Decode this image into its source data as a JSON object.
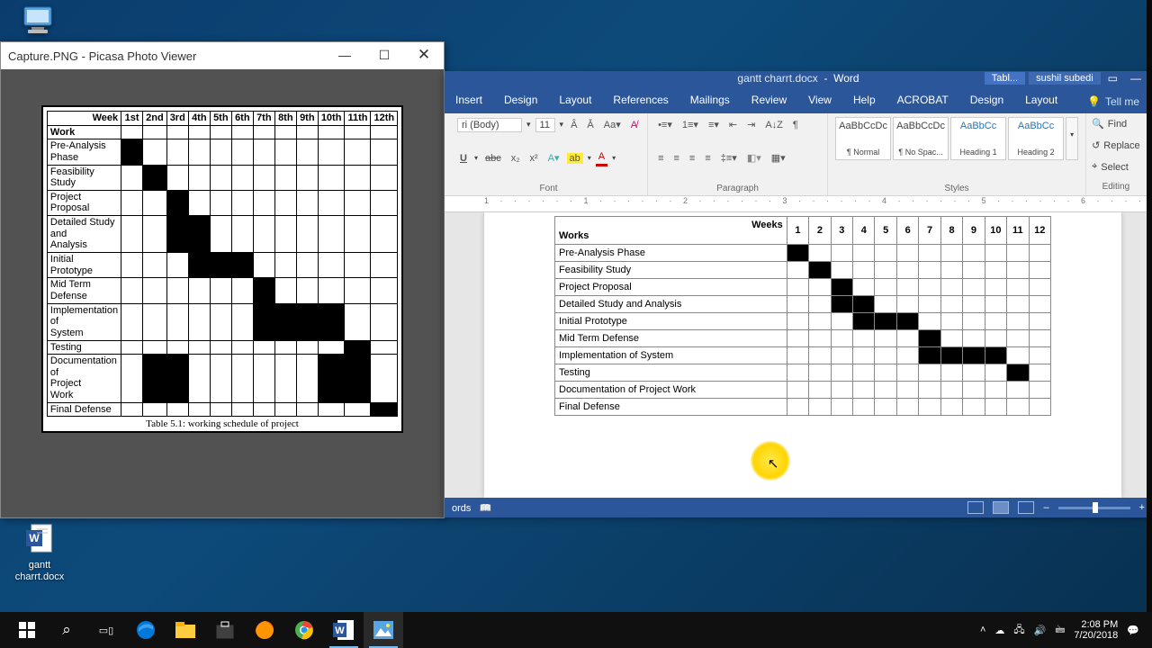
{
  "desktop": {
    "this_pc": "",
    "word_doc_label": "gantt\ncharrt.docx"
  },
  "picasa": {
    "title": "Capture.PNG - Picasa Photo Viewer",
    "caption": "Table 5.1: working schedule of project",
    "header_week_label": "Week",
    "header_work_label": "Work"
  },
  "chart_data": {
    "type": "table",
    "title": "Working schedule of project (Gantt chart)",
    "picasa": {
      "columns": [
        "1st",
        "2nd",
        "3rd",
        "4th",
        "5th",
        "6th",
        "7th",
        "8th",
        "9th",
        "10th",
        "11th",
        "12th"
      ],
      "rows": [
        {
          "name": "Pre-Analysis Phase",
          "cells": [
            1,
            0,
            0,
            0,
            0,
            0,
            0,
            0,
            0,
            0,
            0,
            0
          ]
        },
        {
          "name": "Feasibility Study",
          "cells": [
            0,
            1,
            0,
            0,
            0,
            0,
            0,
            0,
            0,
            0,
            0,
            0
          ]
        },
        {
          "name": "Project Proposal",
          "cells": [
            0,
            0,
            1,
            0,
            0,
            0,
            0,
            0,
            0,
            0,
            0,
            0
          ]
        },
        {
          "name": "Detailed Study and Analysis",
          "cells": [
            0,
            0,
            1,
            1,
            0,
            0,
            0,
            0,
            0,
            0,
            0,
            0
          ]
        },
        {
          "name": "Initial Prototype",
          "cells": [
            0,
            0,
            0,
            1,
            1,
            1,
            0,
            0,
            0,
            0,
            0,
            0
          ]
        },
        {
          "name": "Mid Term Defense",
          "cells": [
            0,
            0,
            0,
            0,
            0,
            0,
            1,
            0,
            0,
            0,
            0,
            0
          ]
        },
        {
          "name": "Implementation of System",
          "cells": [
            0,
            0,
            0,
            0,
            0,
            0,
            1,
            1,
            1,
            1,
            0,
            0
          ]
        },
        {
          "name": "Testing",
          "cells": [
            0,
            0,
            0,
            0,
            0,
            0,
            0,
            0,
            0,
            0,
            1,
            0
          ]
        },
        {
          "name": "Documentation of Project Work",
          "cells": [
            0,
            1,
            1,
            0,
            0,
            0,
            0,
            0,
            0,
            1,
            1,
            0
          ]
        },
        {
          "name": "Final Defense",
          "cells": [
            0,
            0,
            0,
            0,
            0,
            0,
            0,
            0,
            0,
            0,
            0,
            1
          ]
        }
      ]
    },
    "word": {
      "columns": [
        "1",
        "2",
        "3",
        "4",
        "5",
        "6",
        "7",
        "8",
        "9",
        "10",
        "11",
        "12"
      ],
      "rows": [
        {
          "name": "Pre-Analysis Phase",
          "cells": [
            1,
            0,
            0,
            0,
            0,
            0,
            0,
            0,
            0,
            0,
            0,
            0
          ]
        },
        {
          "name": "Feasibility Study",
          "cells": [
            0,
            1,
            0,
            0,
            0,
            0,
            0,
            0,
            0,
            0,
            0,
            0
          ]
        },
        {
          "name": "Project Proposal",
          "cells": [
            0,
            0,
            1,
            0,
            0,
            0,
            0,
            0,
            0,
            0,
            0,
            0
          ]
        },
        {
          "name": "Detailed Study and Analysis",
          "cells": [
            0,
            0,
            1,
            1,
            0,
            0,
            0,
            0,
            0,
            0,
            0,
            0
          ]
        },
        {
          "name": "Initial Prototype",
          "cells": [
            0,
            0,
            0,
            1,
            1,
            1,
            0,
            0,
            0,
            0,
            0,
            0
          ]
        },
        {
          "name": "Mid Term Defense",
          "cells": [
            0,
            0,
            0,
            0,
            0,
            0,
            1,
            0,
            0,
            0,
            0,
            0
          ]
        },
        {
          "name": "Implementation of System",
          "cells": [
            0,
            0,
            0,
            0,
            0,
            0,
            1,
            1,
            1,
            1,
            0,
            0
          ]
        },
        {
          "name": "Testing",
          "cells": [
            0,
            0,
            0,
            0,
            0,
            0,
            0,
            0,
            0,
            0,
            1,
            0
          ]
        },
        {
          "name": "Documentation of Project Work",
          "cells": [
            0,
            0,
            0,
            0,
            0,
            0,
            0,
            0,
            0,
            0,
            0,
            0
          ]
        },
        {
          "name": "Final Defense",
          "cells": [
            0,
            0,
            0,
            0,
            0,
            0,
            0,
            0,
            0,
            0,
            0,
            0
          ]
        }
      ]
    }
  },
  "word": {
    "titlebar": {
      "doc": "gantt charrt.docx",
      "app": "Word",
      "context": "Tabl...",
      "user": "sushil subedi"
    },
    "tabs": [
      "Insert",
      "Design",
      "Layout",
      "References",
      "Mailings",
      "Review",
      "View",
      "Help",
      "ACROBAT"
    ],
    "tool_tabs": [
      "Design",
      "Layout"
    ],
    "tell_me": "Tell me",
    "font": {
      "name": "ri (Body)",
      "size": "11",
      "group": "Font"
    },
    "paragraph_group": "Paragraph",
    "styles_group": "Styles",
    "editing_group": "Editing",
    "styles": [
      {
        "preview": "AaBbCcDc",
        "name": "¶ Normal"
      },
      {
        "preview": "AaBbCcDc",
        "name": "¶ No Spac..."
      },
      {
        "preview": "AaBbCc",
        "name": "Heading 1"
      },
      {
        "preview": "AaBbCc",
        "name": "Heading 2"
      }
    ],
    "editing": {
      "find": "Find",
      "replace": "Replace",
      "select": "Select"
    },
    "table": {
      "weeks_label": "Weeks",
      "works_label": "Works"
    },
    "status": {
      "words": "ords",
      "views": true
    }
  },
  "taskbar": {
    "time": "2:08 PM",
    "date": "7/20/2018"
  }
}
